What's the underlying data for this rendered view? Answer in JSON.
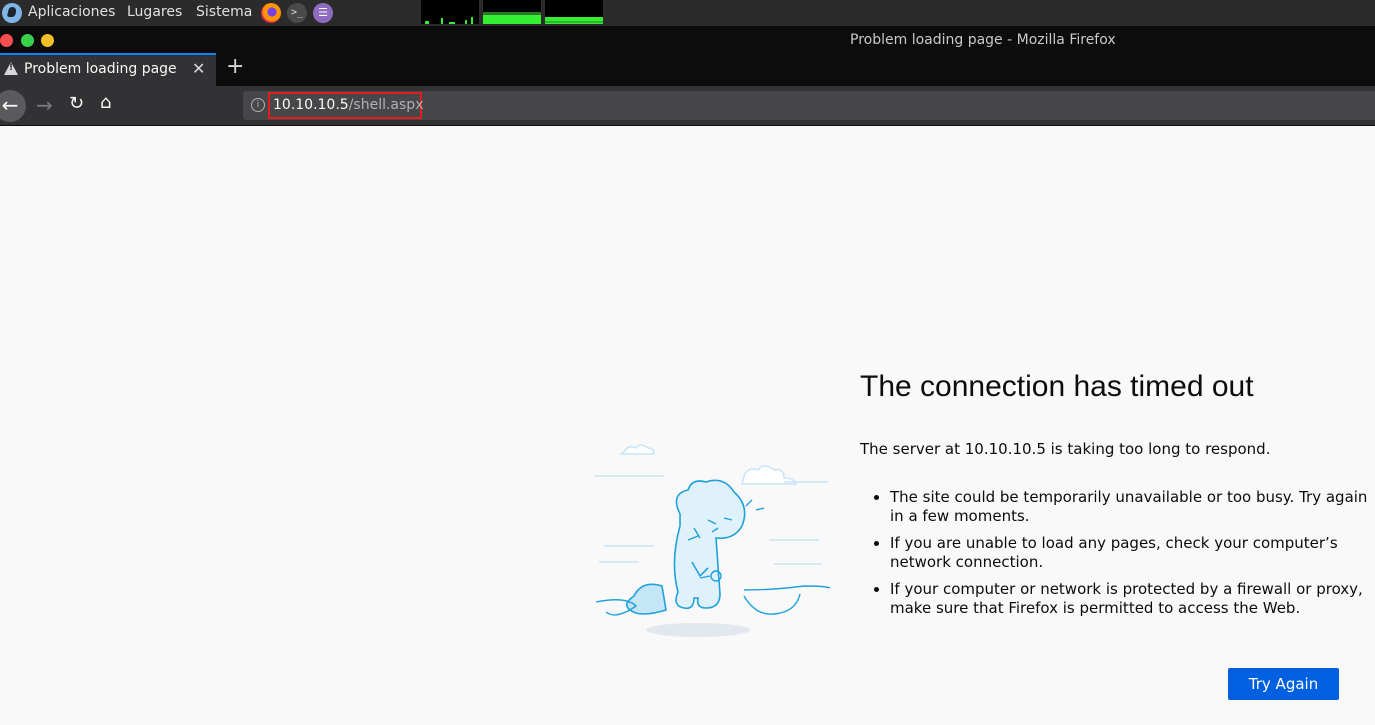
{
  "os_panel": {
    "menus": [
      "Aplicaciones",
      "Lugares",
      "Sistema"
    ],
    "launchers": [
      "firefox-icon",
      "terminal-icon",
      "text-editor-icon"
    ]
  },
  "window": {
    "title": "Problem loading page - Mozilla Firefox"
  },
  "tabs": [
    {
      "label": "Problem loading page",
      "icon": "warning-icon"
    }
  ],
  "navigation": {
    "url_host": "10.10.10.5",
    "url_path": "/shell.aspx"
  },
  "error_page": {
    "heading": "The connection has timed out",
    "description": "The server at 10.10.10.5 is taking too long to respond.",
    "reasons": [
      "The site could be temporarily unavailable or too busy. Try again in a few moments.",
      "If you are unable to load any pages, check your computer’s network connection.",
      "If your computer or network is protected by a firewall or proxy, make sure that Firefox is permitted to access the Web."
    ],
    "try_again_label": "Try Again"
  },
  "colors": {
    "accent": "#0060df",
    "highlight": "#e31b1b",
    "tab_indicator": "#0a84ff",
    "monitor_fill": "#33ee33"
  }
}
